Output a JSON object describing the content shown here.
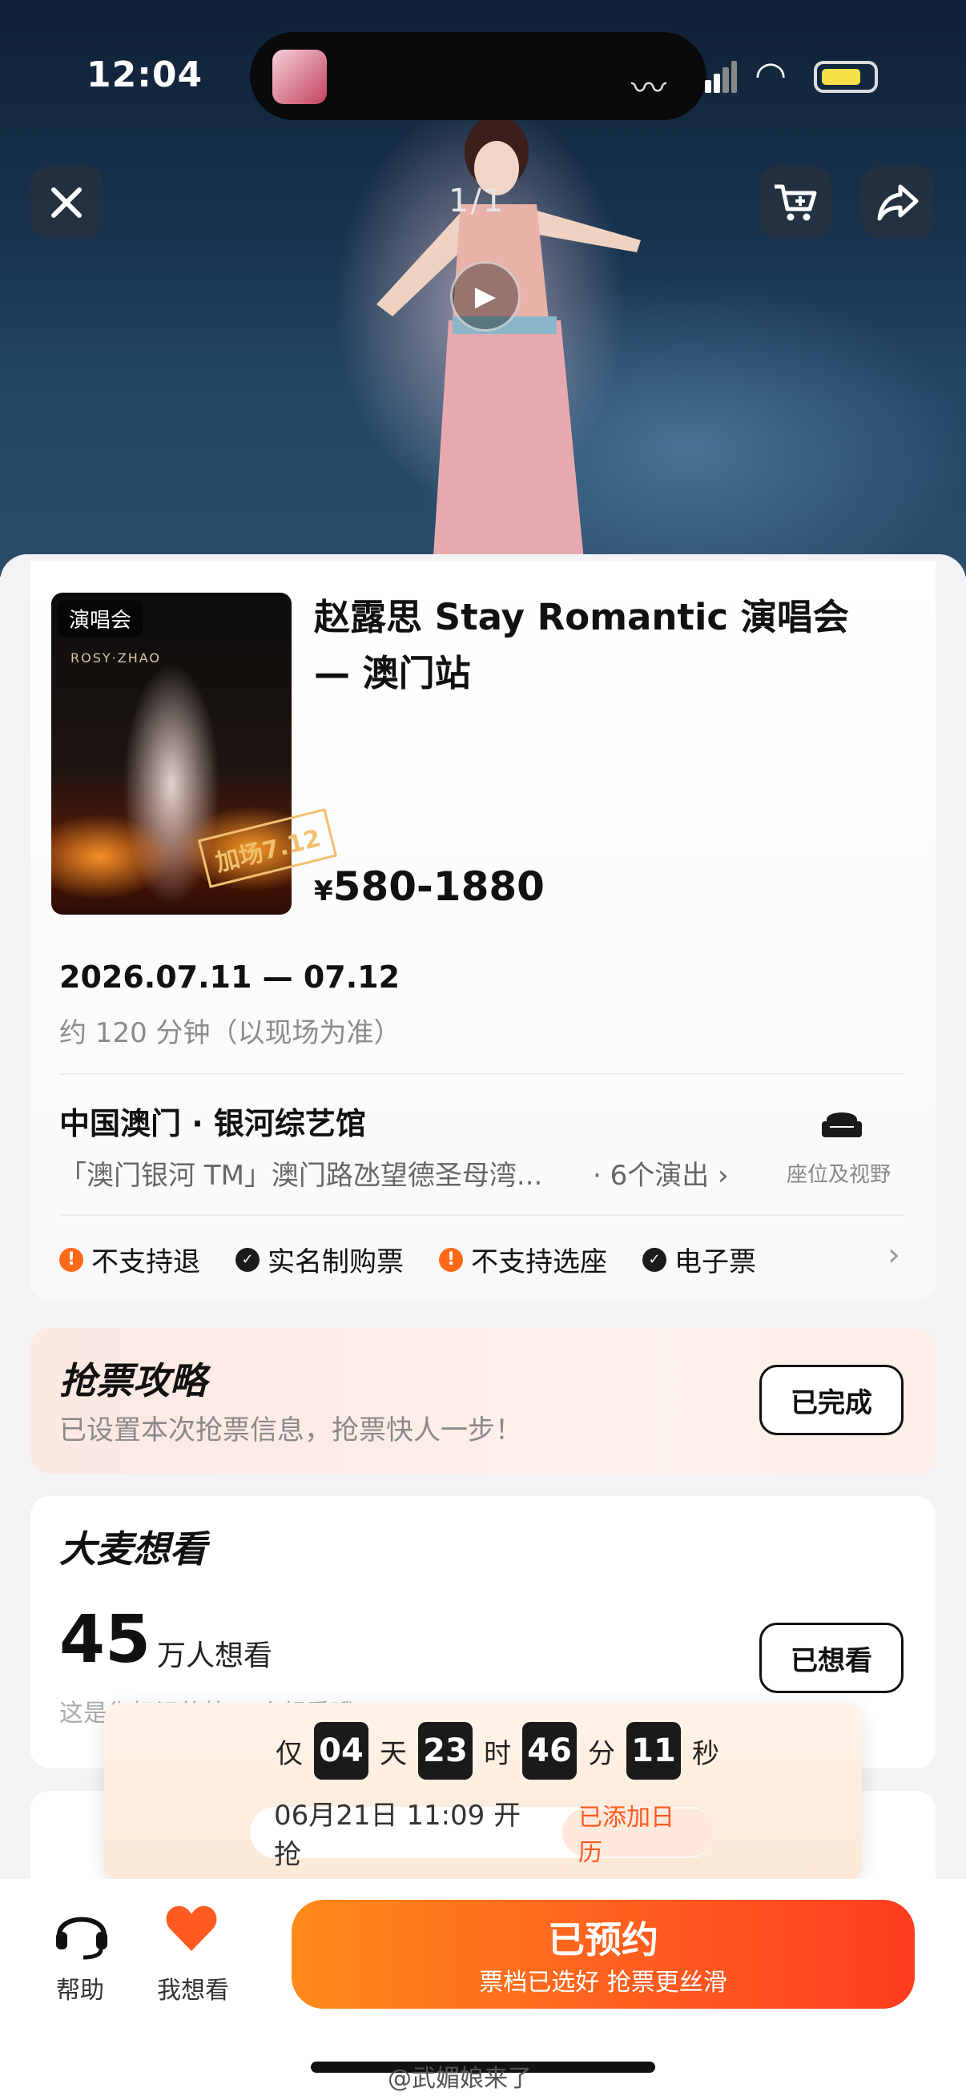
{
  "status_bar": {
    "time": "12:04"
  },
  "hero": {
    "counter": "1/1"
  },
  "event": {
    "poster_tag": "演唱会",
    "poster_brand": "ROSY·ZHAO",
    "poster_stamp": "加场7.12",
    "title": "赵露思 Stay Romantic 演唱会 — 澳门站",
    "price_symbol": "¥",
    "price": "580-1880",
    "date": "2026.07.11 — 07.12",
    "duration": "约 120 分钟（以现场为准）",
    "venue": "中国澳门 · 银河综艺馆",
    "address": "「澳门银河 TM」澳门路氹望德圣母湾...",
    "shows": "· 6个演出 ›",
    "seat_label": "座位及视野",
    "notices": [
      "不支持退",
      "实名制购票",
      "不支持选座",
      "电子票"
    ]
  },
  "strategy": {
    "title": "抢票攻略",
    "subtitle": "已设置本次抢票信息，抢票快人一步！",
    "button": "已完成"
  },
  "want": {
    "title": "大麦想看",
    "count": "45",
    "unit": "万人想看",
    "subtitle": "这是你标记的第 2 个想看哦",
    "button": "已想看"
  },
  "countdown": {
    "prefix": "仅",
    "days": "04",
    "days_label": "天",
    "hours": "23",
    "hours_label": "时",
    "minutes": "46",
    "minutes_label": "分",
    "seconds": "11",
    "seconds_label": "秒",
    "open_time": "06月21日 11:09 开抢",
    "calendar_tag": "已添加日历"
  },
  "bottom_bar": {
    "help_label": "帮助",
    "want_label": "我想看",
    "cta_main": "已预约",
    "cta_sub": "票档已选好 抢票更丝滑"
  },
  "watermark": "@武媚娘来了",
  "colors": {
    "accent": "#ff5a1f",
    "accent_start": "#ff8a1a",
    "warning": "#ff6a1a"
  }
}
